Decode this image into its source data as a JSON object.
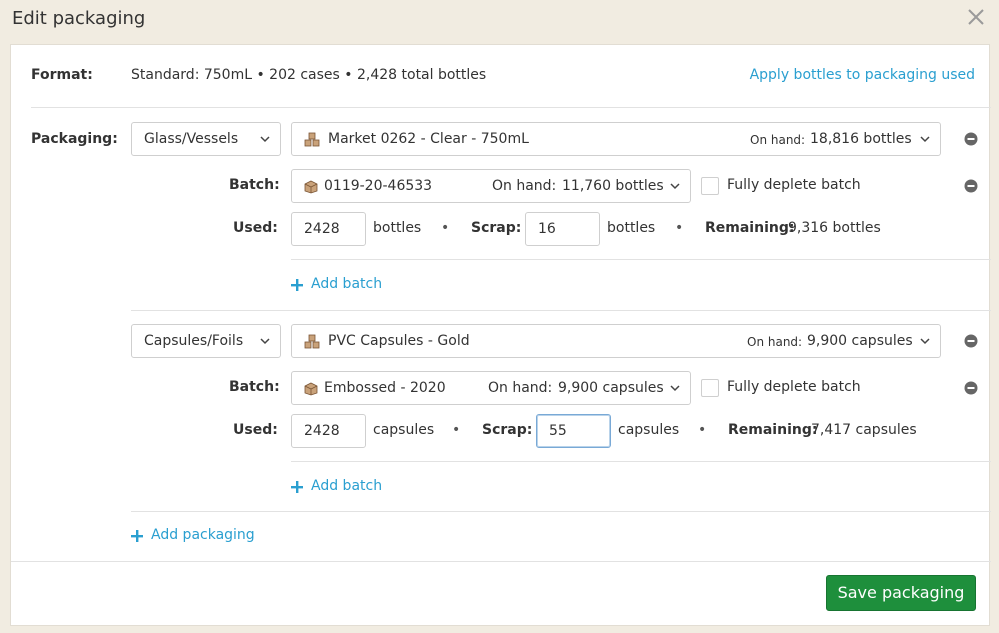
{
  "dialog": {
    "title": "Edit packaging",
    "format_label": "Format:",
    "format_value": "Standard: 750mL • 202 cases • 2,428 total bottles",
    "apply_link": "Apply bottles to packaging used",
    "packaging_label": "Packaging:",
    "add_packaging": "Add packaging",
    "save_label": "Save packaging"
  },
  "common": {
    "batch_label": "Batch:",
    "used_label": "Used:",
    "scrap_label": "Scrap:",
    "remaining_label": "Remaining:",
    "onhand_label": "On hand:",
    "fully_deplete": "Fully deplete batch",
    "add_batch": "Add batch",
    "bullet": "•"
  },
  "groups": [
    {
      "category": "Glass/Vessels",
      "item_name": "Market 0262 - Clear - 750mL",
      "item_onhand": "18,816 bottles",
      "batch_name": "0119-20-46533",
      "batch_onhand": "11,760 bottles",
      "used": "2428",
      "used_unit": "bottles",
      "scrap": "16",
      "scrap_unit": "bottles",
      "remaining": "9,316 bottles"
    },
    {
      "category": "Capsules/Foils",
      "item_name": "PVC Capsules - Gold",
      "item_onhand": "9,900 capsules",
      "batch_name": "Embossed - 2020",
      "batch_onhand": "9,900 capsules",
      "used": "2428",
      "used_unit": "capsules",
      "scrap": "55",
      "scrap_unit": "capsules",
      "remaining": "7,417 capsules"
    }
  ],
  "colors": {
    "accent_link": "#2a9fd0",
    "save_button": "#1e8f3c",
    "background": "#f1ece1"
  }
}
